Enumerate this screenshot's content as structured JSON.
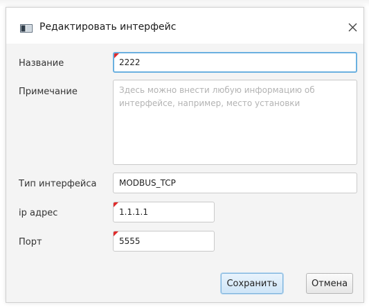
{
  "dialog": {
    "title": "Редактировать интерфейс",
    "icon": "window-icon",
    "close_icon": "close-icon"
  },
  "form": {
    "name": {
      "label": "Название",
      "value": "2222",
      "required": true
    },
    "note": {
      "label": "Примечание",
      "value": "",
      "placeholder": "Здесь можно внести любую информацию об интерфейсе, например, место установки"
    },
    "interface_type": {
      "label": "Тип интерфейса",
      "value": "MODBUS_TCP"
    },
    "ip": {
      "label": "ip адрес",
      "value": "1.1.1.1",
      "required": true
    },
    "port": {
      "label": "Порт",
      "value": "5555",
      "required": true
    }
  },
  "buttons": {
    "save": "Сохранить",
    "cancel": "Отмена"
  },
  "colors": {
    "focus_border": "#6ab0e0",
    "required_marker": "#e02a2a",
    "primary_button": "#cfe5f7"
  }
}
